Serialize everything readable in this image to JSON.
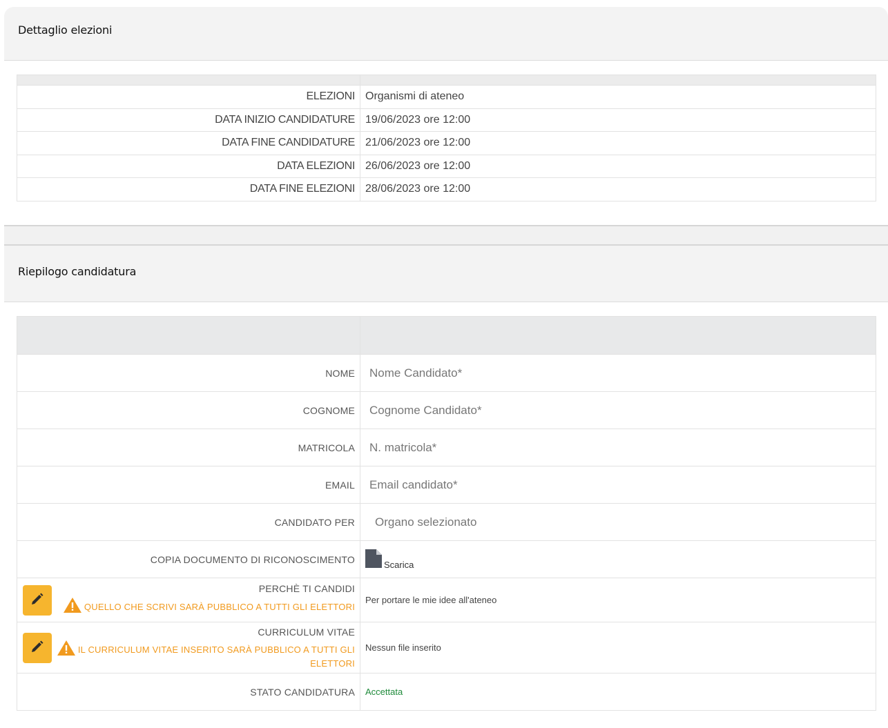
{
  "election_section": {
    "title": "Dettaglio elezioni",
    "rows": [
      {
        "label": "ELEZIONI",
        "value": "Organismi di ateneo"
      },
      {
        "label": "DATA INIZIO CANDIDATURE",
        "value": "19/06/2023 ore 12:00"
      },
      {
        "label": "DATA FINE CANDIDATURE",
        "value": "21/06/2023 ore 12:00"
      },
      {
        "label": "DATA ELEZIONI",
        "value": "26/06/2023 ore 12:00"
      },
      {
        "label": "DATA FINE ELEZIONI",
        "value": "28/06/2023 ore 12:00"
      }
    ]
  },
  "candidature_section": {
    "title": "Riepilogo candidatura",
    "name": {
      "label": "NOME",
      "value": "Nome Candidato*"
    },
    "surname": {
      "label": "COGNOME",
      "value": "Cognome Candidato*"
    },
    "matricola": {
      "label": "MATRICOLA",
      "value": "N. matricola*"
    },
    "email": {
      "label": "EMAIL",
      "value": "Email candidato*"
    },
    "candidate_for": {
      "label": "CANDIDATO PER",
      "value": "Organo selezionato"
    },
    "id_document": {
      "label": "COPIA DOCUMENTO DI RICONOSCIMENTO",
      "link": "Scarica",
      "icon": "document-icon"
    },
    "why": {
      "label": "PERCHÈ TI CANDIDI",
      "warning": "QUELLO CHE SCRIVI SARÀ PUBBLICO A TUTTI GLI ELETTORI",
      "value": "Per portare le mie idee all'ateneo"
    },
    "cv": {
      "label": "CURRICULUM VITAE",
      "warning_line1": "IL CURRICULUM VITAE INSERITO SARÀ PUBBLICO A TUTTI GLI",
      "warning_line2": "ELETTORI",
      "value": "Nessun file inserito"
    },
    "status": {
      "label": "STATO CANDIDATURA",
      "value": "Accettata"
    }
  },
  "colors": {
    "warning": "#f19a1e",
    "edit_button": "#f6b52e",
    "accepted": "#1e8a3a"
  }
}
